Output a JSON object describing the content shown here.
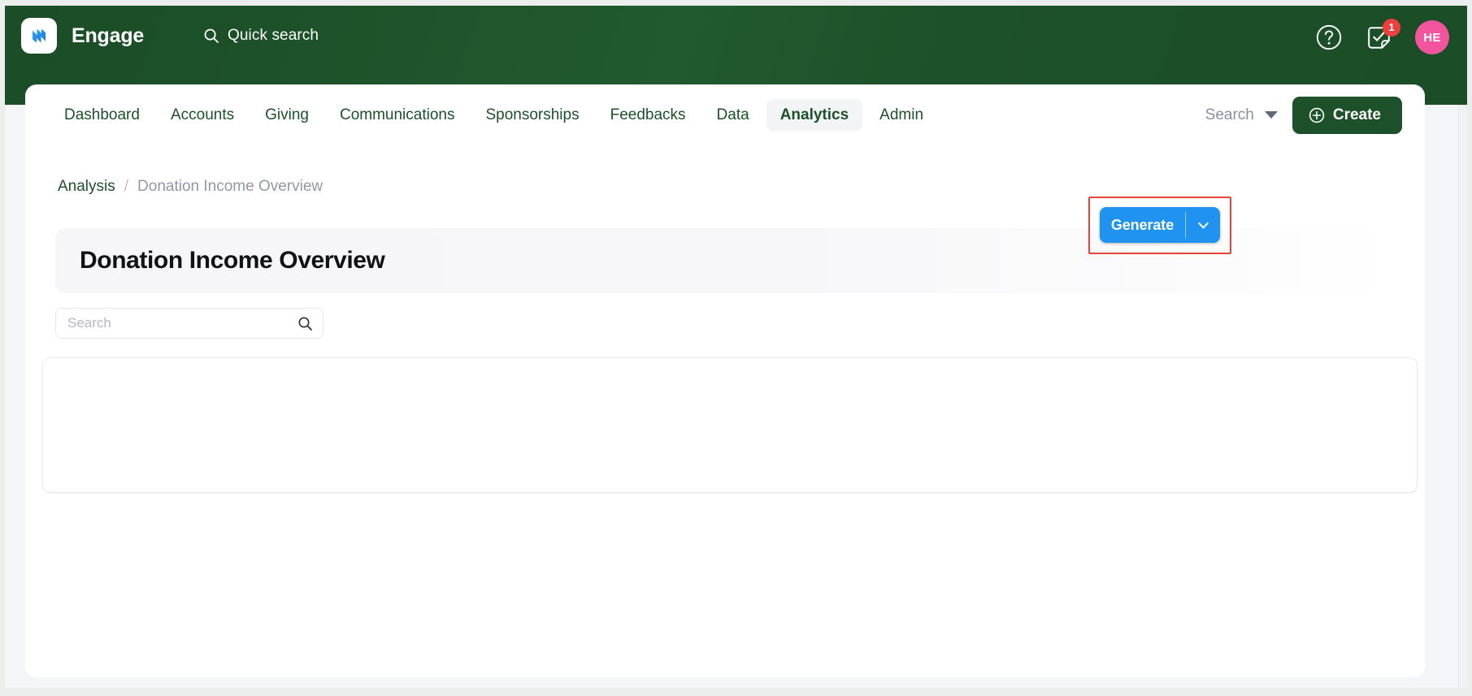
{
  "header": {
    "brand": "Engage",
    "logo_icon": "engage-logo-icon",
    "quick_search": {
      "label": "Quick search",
      "icon": "search-icon"
    },
    "help_icon": "help-circle-icon",
    "tasks": {
      "icon": "task-checkbox-icon",
      "badge_count": "1"
    },
    "avatar_initials": "HE",
    "colors": {
      "header_green": "#1d5129",
      "avatar_pink": "#f2559e",
      "badge_red": "#ef3e3e"
    }
  },
  "nav": {
    "items": [
      {
        "label": "Dashboard",
        "active": false
      },
      {
        "label": "Accounts",
        "active": false
      },
      {
        "label": "Giving",
        "active": false
      },
      {
        "label": "Communications",
        "active": false
      },
      {
        "label": "Sponsorships",
        "active": false
      },
      {
        "label": "Feedbacks",
        "active": false
      },
      {
        "label": "Data",
        "active": false
      },
      {
        "label": "Analytics",
        "active": true
      },
      {
        "label": "Admin",
        "active": false
      }
    ],
    "search_dropdown": {
      "label": "Search",
      "icon": "chevron-down-icon"
    },
    "create_button": {
      "label": "Create",
      "icon": "plus-circle-icon"
    }
  },
  "breadcrumb": {
    "parent": "Analysis",
    "separator": "/",
    "current": "Donation Income Overview"
  },
  "page": {
    "title": "Donation Income Overview"
  },
  "generate": {
    "label": "Generate",
    "caret_icon": "chevron-down-icon",
    "accent_color": "#1f93ef",
    "annotation_color": "#e8433b"
  },
  "search": {
    "value": "",
    "placeholder": "Search",
    "icon": "search-icon"
  },
  "results": {
    "rows": []
  }
}
